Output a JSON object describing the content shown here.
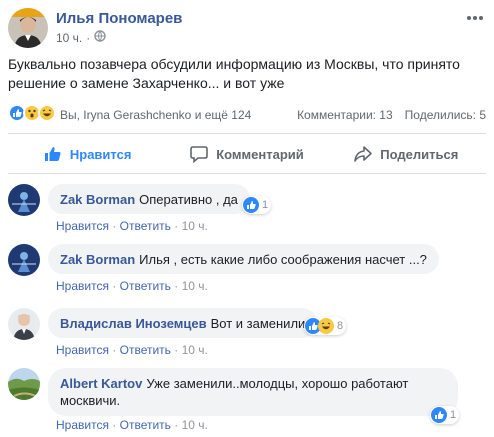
{
  "post": {
    "author": "Илья Пономарев",
    "time": "10 ч.",
    "text": "Буквально позавчера обсудили информацию из Москвы, что принято решение о замене Захарченко... и вот уже",
    "reactors": "Вы, Iryna Gerashchenko и ещё 124",
    "comments_count": "Комментарии: 13",
    "shares_count": "Поделились: 5",
    "colors": {
      "link": "#385898",
      "accent": "#2d88ff",
      "muted": "#606770"
    }
  },
  "actions": {
    "like": "Нравится",
    "comment": "Комментарий",
    "share": "Поделиться"
  },
  "comments": [
    {
      "author": "Zak Borman",
      "text": "Оперативно , да",
      "like": "Нравится",
      "reply": "Ответить",
      "time": "10 ч.",
      "reaction_count": "1"
    },
    {
      "author": "Zak Borman",
      "text": "Илья , есть какие либо соображения насчет ...?",
      "like": "Нравится",
      "reply": "Ответить",
      "time": "10 ч."
    },
    {
      "author": "Владислав Иноземцев",
      "text": "Вот и заменили",
      "like": "Нравится",
      "reply": "Ответить",
      "time": "10 ч.",
      "reaction_count": "8"
    },
    {
      "author": "Albert Kartov",
      "text": "Уже заменили..молодцы, хорошо работают москвичи.",
      "like": "Нравится",
      "reply": "Ответить",
      "time": "10 ч.",
      "reaction_count": "1"
    }
  ],
  "separator": "·"
}
